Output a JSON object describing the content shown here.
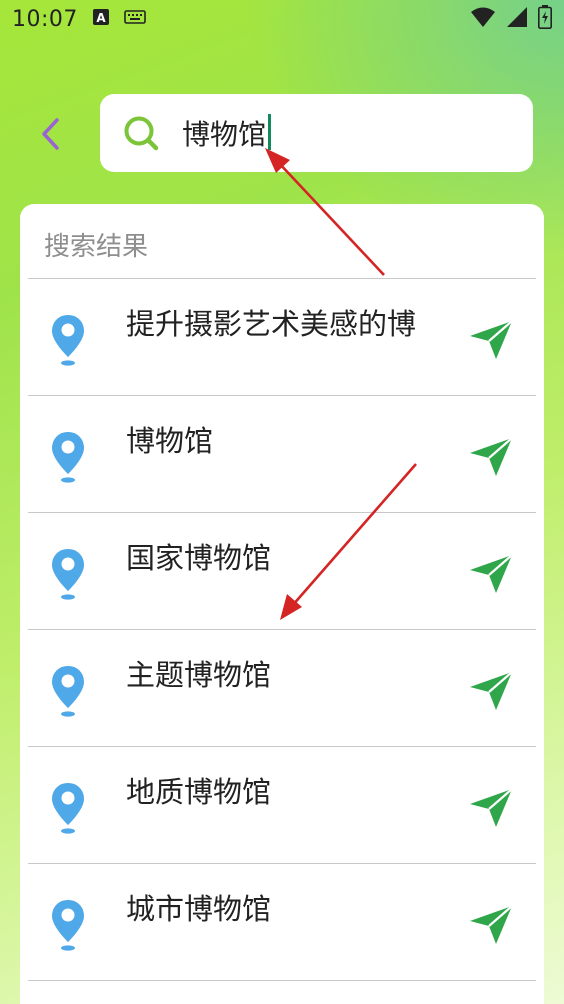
{
  "status_bar": {
    "time": "10:07",
    "icons": [
      "a-notification-icon",
      "keyboard-icon",
      "wifi-icon",
      "signal-icon",
      "battery-charging-icon"
    ]
  },
  "search": {
    "value": "博物馆",
    "icon": "search-icon",
    "accent": "#7cc43a"
  },
  "back": {
    "icon": "chevron-left-icon",
    "color": "#9a63d4"
  },
  "results": {
    "title": "搜索结果",
    "pin_color": "#4fa8e8",
    "nav_color": "#2fa64a",
    "items": [
      {
        "label": "提升摄影艺术美感的博"
      },
      {
        "label": "博物馆"
      },
      {
        "label": "国家博物馆"
      },
      {
        "label": "主题博物馆"
      },
      {
        "label": "地质博物馆"
      },
      {
        "label": "城市博物馆"
      }
    ]
  },
  "annotation_color": "#d42424"
}
